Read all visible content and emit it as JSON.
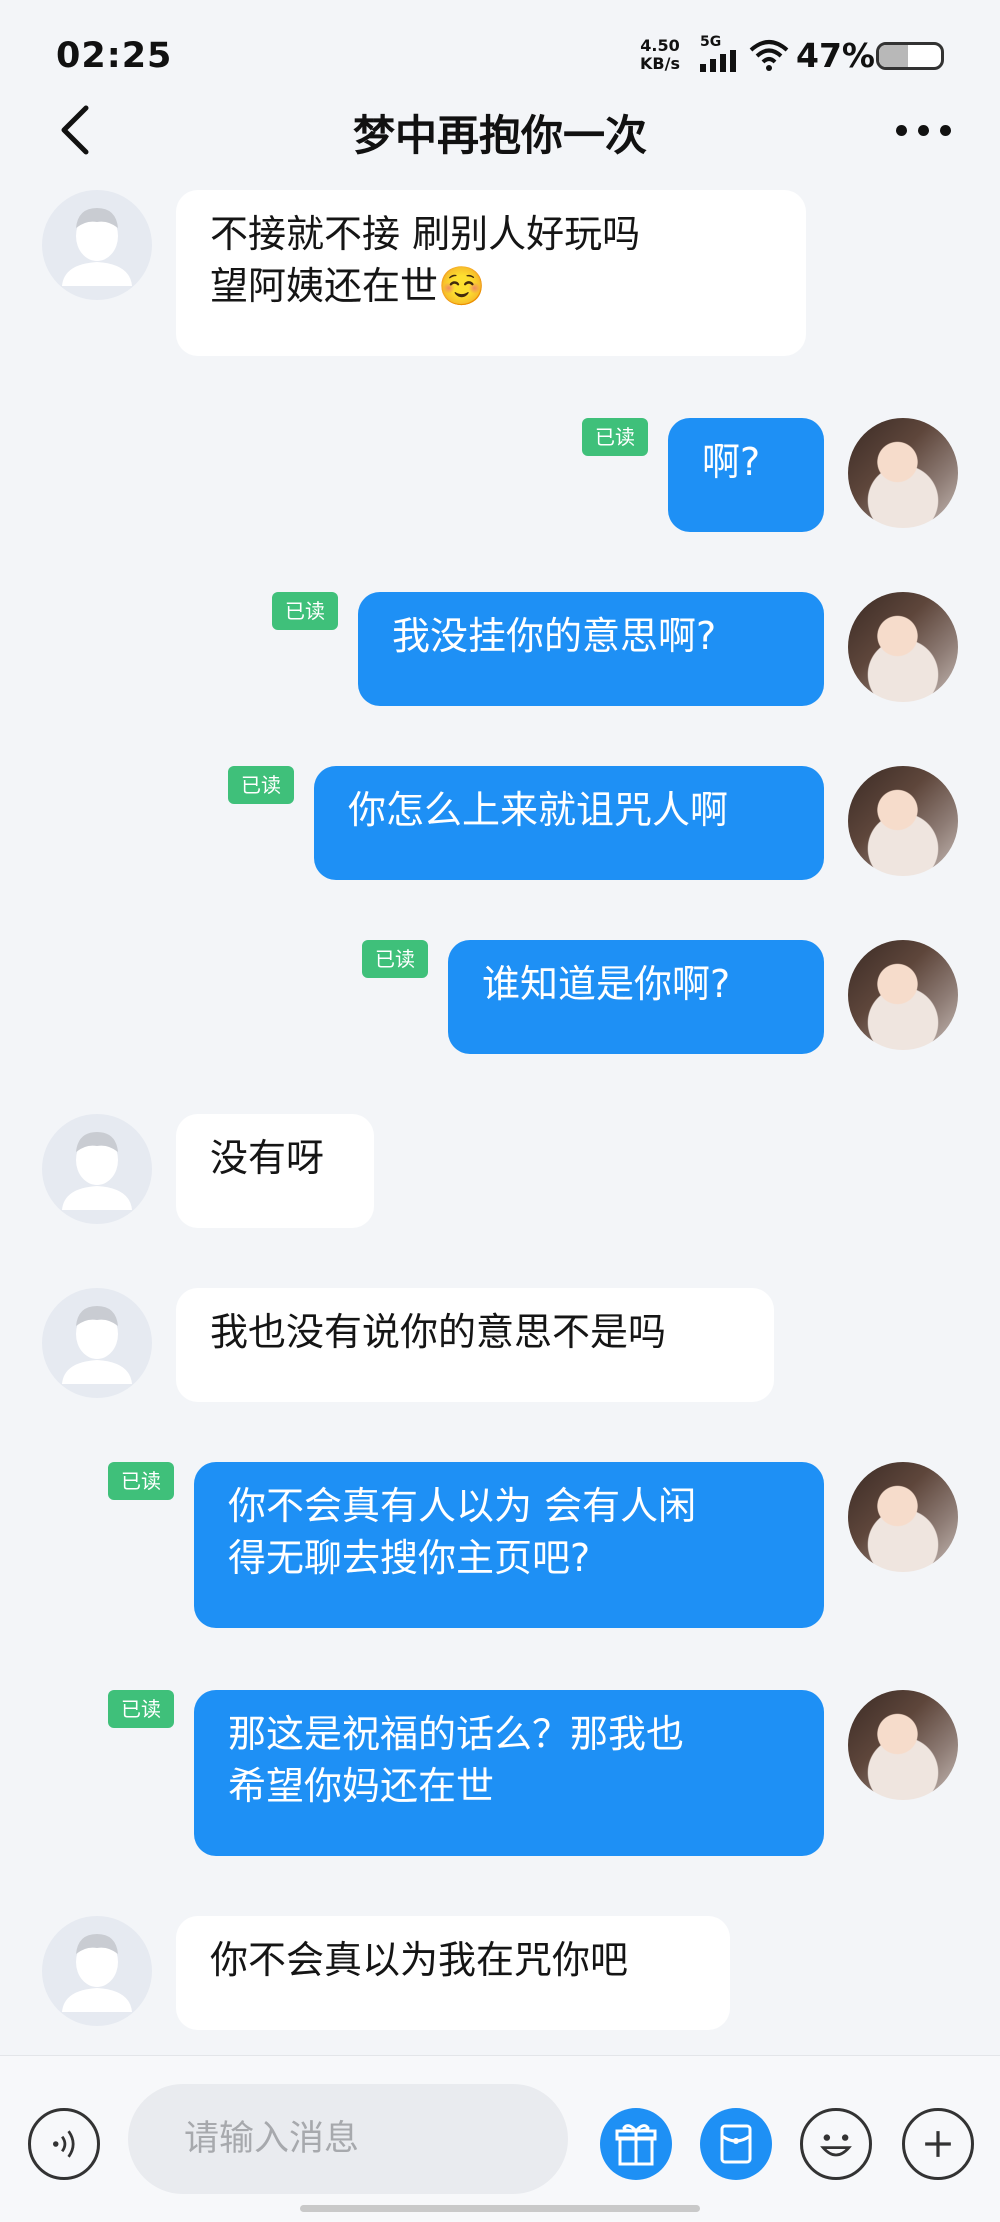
{
  "status_bar": {
    "time": "02:25",
    "net_speed_value": "4.50",
    "net_speed_unit": "KB/s",
    "network": "5G",
    "battery_percent": "47%",
    "battery_level": 0.47
  },
  "header": {
    "title": "梦中再抱你一次",
    "back_icon": "chevron-left-icon",
    "more_icon": "more-horizontal-icon"
  },
  "messages": [
    {
      "side": "in",
      "text": "不接就不接  刷别人好玩吗\n望阿姨还在世☺️"
    },
    {
      "side": "out",
      "text": "啊?",
      "read": "已读"
    },
    {
      "side": "out",
      "text": "我没挂你的意思啊?",
      "read": "已读"
    },
    {
      "side": "out",
      "text": "你怎么上来就诅咒人啊",
      "read": "已读"
    },
    {
      "side": "out",
      "text": "谁知道是你啊?",
      "read": "已读"
    },
    {
      "side": "in",
      "text": "没有呀"
    },
    {
      "side": "in",
      "text": "我也没有说你的意思不是吗"
    },
    {
      "side": "out",
      "text": "你不会真有人以为 会有人闲\n得无聊去搜你主页吧?",
      "read": "已读"
    },
    {
      "side": "out",
      "text": "那这是祝福的话么？那我也\n希望你妈还在世",
      "read": "已读"
    },
    {
      "side": "in",
      "text": "你不会真以为我在咒你吧"
    }
  ],
  "input_bar": {
    "placeholder": "请输入消息",
    "icons": [
      "voice-icon",
      "gift-icon",
      "red-packet-icon",
      "emoji-icon",
      "plus-icon"
    ]
  },
  "colors": {
    "outgoing_bubble": "#1e90f5",
    "incoming_bubble": "#ffffff",
    "read_badge": "#3fc07a",
    "background": "#f3f5f8"
  }
}
